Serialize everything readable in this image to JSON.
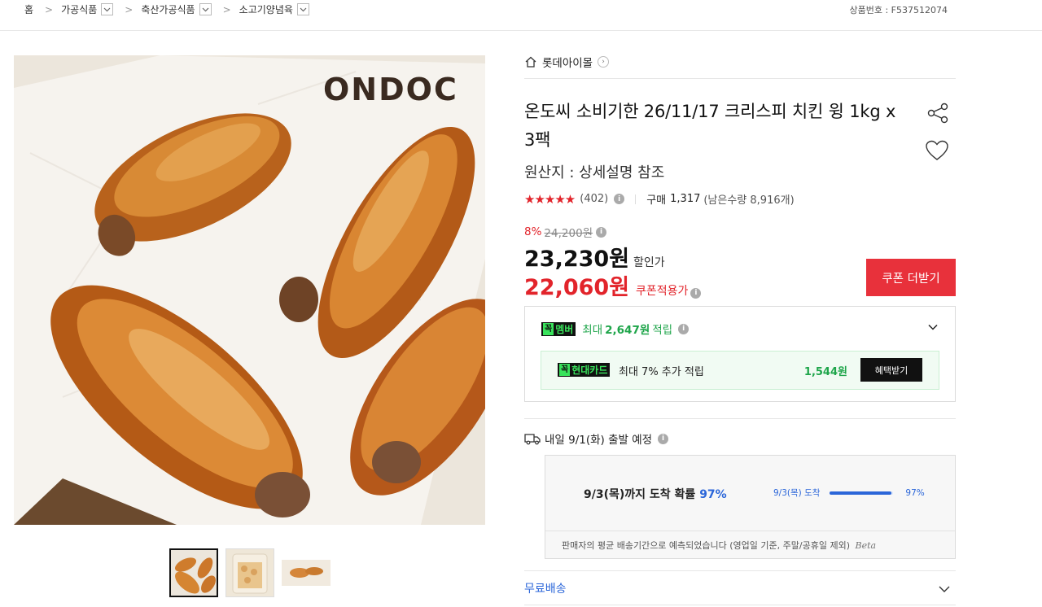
{
  "breadcrumb": {
    "home": "홈",
    "items": [
      "가공식품",
      "축산가공식품",
      "소고기양념육"
    ]
  },
  "product_number": "상품번호 : F537512074",
  "gallery": {
    "logo_text": "ONDOC",
    "thumbnail_count": 3
  },
  "store": {
    "name": "롯데아이몰"
  },
  "product": {
    "title": "온도씨 소비기한 26/11/17 크리스피 치킨 윙 1kg x 3팩",
    "origin": "원산지 : 상세설명 참조"
  },
  "rating": {
    "stars_value": 4.5,
    "stars_display": "★★★★★",
    "review_count": "(402)",
    "purchase_label": "구매",
    "purchase_count": "1,317",
    "stock": "(남은수량 8,916개)"
  },
  "price": {
    "discount_pct": "8%",
    "original": "24,200원",
    "sale": "23,230원",
    "sale_label": "할인가",
    "coupon_price": "22,060원",
    "coupon_label": "쿠폰적용가",
    "coupon_button": "쿠폰 더받기"
  },
  "member": {
    "badge_glyph": "꼭",
    "badge_label": "멤버",
    "max_prefix": "최대",
    "max_amount": "2,647원",
    "max_suffix": "적립",
    "card_badge_label": "현대카드",
    "card_text": "최대 7% 추가 적립",
    "card_amount": "1,544원",
    "benefit_button": "혜택받기"
  },
  "shipping": {
    "schedule": "내일 9/1(화) 출발 예정",
    "eta_text": "9/3(목)까지 도착 확률",
    "eta_pct": "97%",
    "bar_label": "9/3(목) 도착",
    "bar_value": 0.97,
    "bar_pct": "97%",
    "note": "판매자의 평균 배송기간으로 예측되었습니다 (영업일 기준, 주말/공휴일 제외)",
    "note_tag": "Beta",
    "free_shipping": "무료배송"
  },
  "colors": {
    "accent_red": "#e2242b",
    "button_red": "#e8313b",
    "member_green": "#1ea54a",
    "badge_green": "#39e35c",
    "link_blue": "#2b66d9"
  }
}
